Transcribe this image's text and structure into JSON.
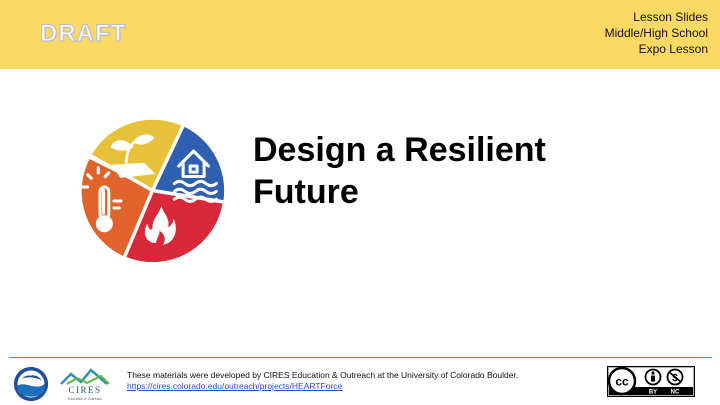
{
  "header": {
    "draft_label": "DRAFT",
    "lesson_lines": [
      "Lesson Slides",
      "Middle/High School",
      "Expo Lesson"
    ]
  },
  "title": {
    "line1": "Design a Resilient",
    "line2": "Future"
  },
  "pie_icons": [
    {
      "name": "plant-drought-icon",
      "color": "#e8c13a"
    },
    {
      "name": "flood-house-icon",
      "color": "#2f5fb0"
    },
    {
      "name": "fire-icon",
      "color": "#d9283a"
    },
    {
      "name": "heat-thermometer-icon",
      "color": "#e0632c"
    }
  ],
  "footer": {
    "credit_text": "These materials were developed by CIRES Education & Outreach at the University of Colorado Boulder.",
    "credit_link": "https://cires.colorado.edu/outreach/projects/HEARTForce",
    "noaa_label": "NOAA",
    "cires_label": "CIRES",
    "cires_sub": "Education & Outreach",
    "license_labels": [
      "BY",
      "NC"
    ]
  },
  "colors": {
    "header_band": "#fcd964",
    "divider": "#4a90d9",
    "link": "#1a55c8"
  }
}
